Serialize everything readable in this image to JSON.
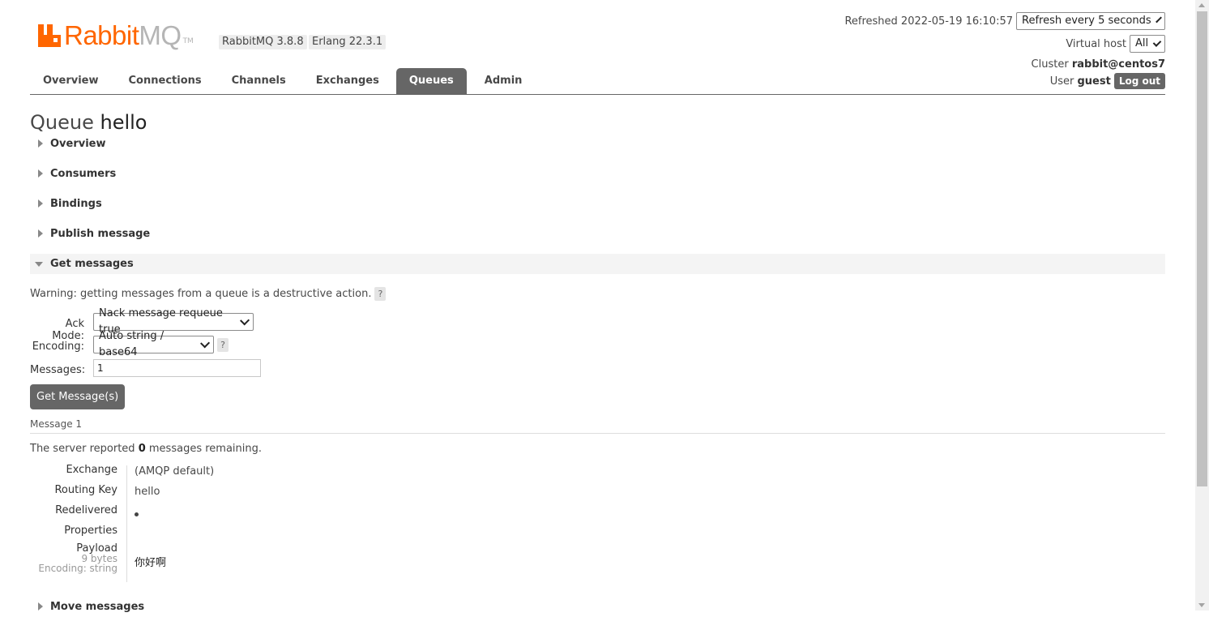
{
  "header": {
    "logo_brand": "Rabbit",
    "logo_suffix": "MQ",
    "logo_tm": "TM",
    "version_rabbit": "RabbitMQ 3.8.8",
    "version_erlang": "Erlang 22.3.1",
    "refreshed_label": "Refreshed 2022-05-19 16:10:57",
    "refresh_select": "Refresh every 5 seconds",
    "vhost_label": "Virtual host",
    "vhost_select": "All",
    "cluster_label": "Cluster",
    "cluster_name": "rabbit@centos7",
    "user_label": "User",
    "user_name": "guest",
    "logout_label": "Log out"
  },
  "tabs": [
    {
      "label": "Overview",
      "active": false
    },
    {
      "label": "Connections",
      "active": false
    },
    {
      "label": "Channels",
      "active": false
    },
    {
      "label": "Exchanges",
      "active": false
    },
    {
      "label": "Queues",
      "active": true
    },
    {
      "label": "Admin",
      "active": false
    }
  ],
  "page": {
    "title_prefix": "Queue",
    "queue_name": "hello"
  },
  "sections": {
    "overview": "Overview",
    "consumers": "Consumers",
    "bindings": "Bindings",
    "publish": "Publish message",
    "get": "Get messages",
    "move": "Move messages"
  },
  "get_messages": {
    "warning": "Warning: getting messages from a queue is a destructive action.",
    "help": "?",
    "ack_mode_label": "Ack Mode:",
    "ack_mode_value": "Nack message requeue true",
    "encoding_label": "Encoding:",
    "encoding_value": "Auto string / base64",
    "messages_label": "Messages:",
    "messages_value": "1",
    "button": "Get Message(s)"
  },
  "result": {
    "message_heading": "Message 1",
    "remaining_prefix": "The server reported",
    "remaining_count": "0",
    "remaining_suffix": "messages remaining.",
    "exchange_label": "Exchange",
    "exchange_value": "(AMQP default)",
    "routing_key_label": "Routing Key",
    "routing_key_value": "hello",
    "redelivered_label": "Redelivered",
    "properties_label": "Properties",
    "payload_label": "Payload",
    "payload_size": "9 bytes",
    "payload_encoding": "Encoding: string",
    "payload_value": "你好啊"
  },
  "colors": {
    "brand_orange": "#ff6600",
    "tab_active": "#666666"
  }
}
